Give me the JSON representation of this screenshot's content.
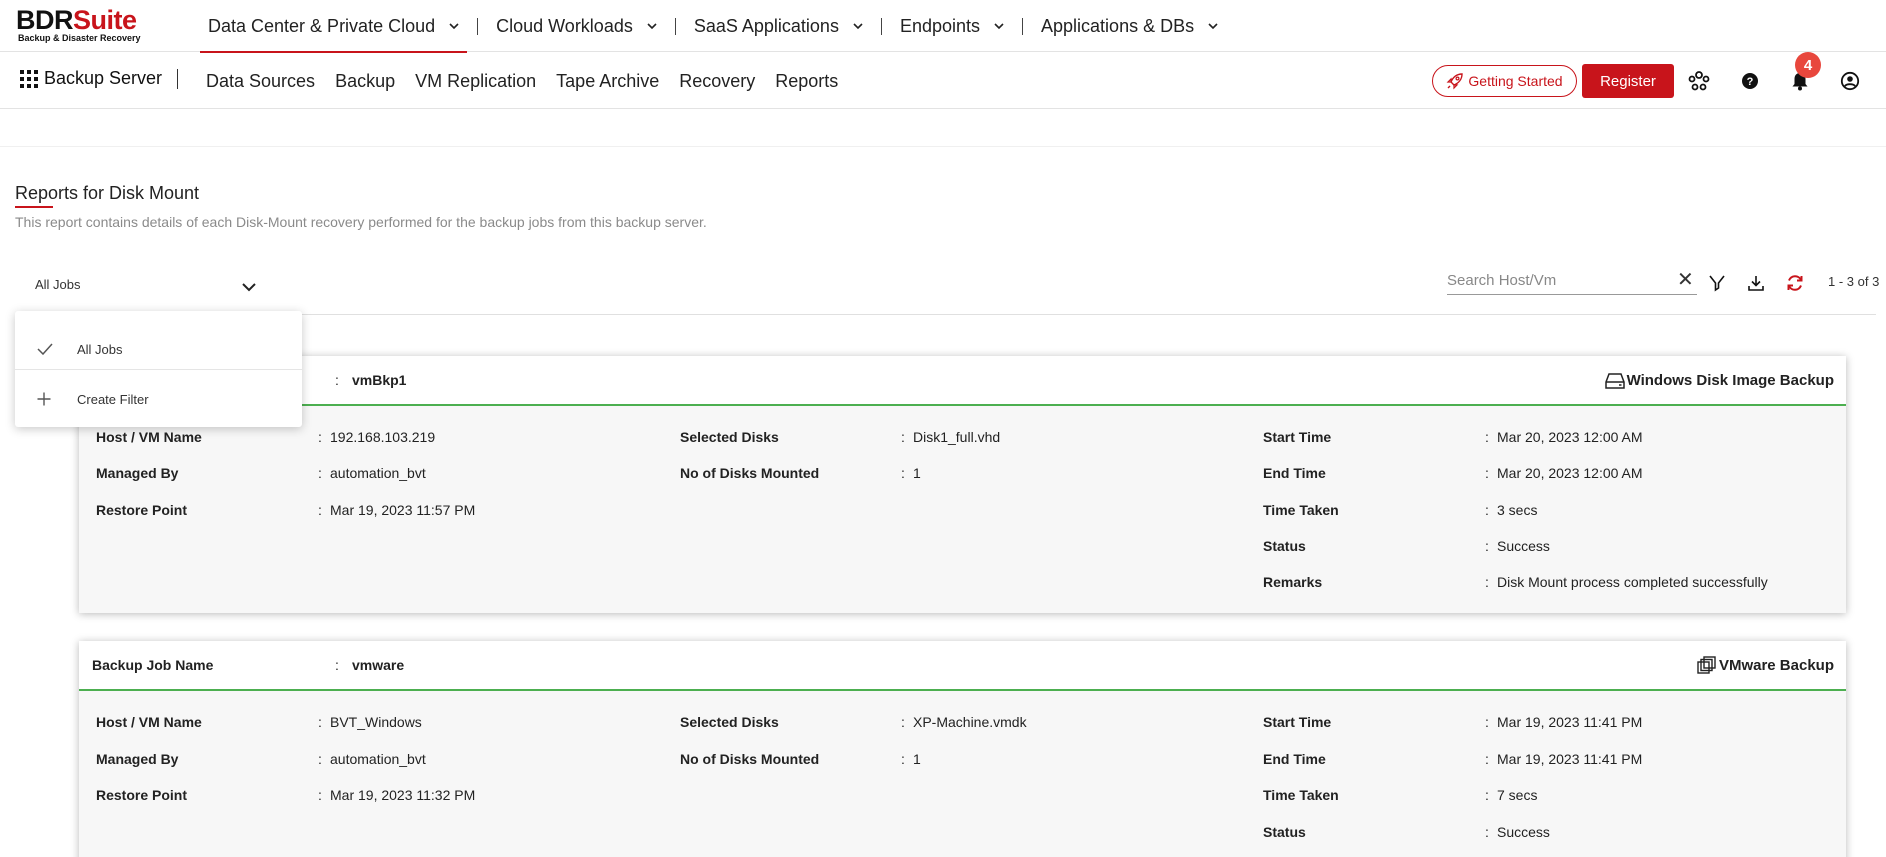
{
  "brand": {
    "name_a": "BDR",
    "name_b": "Suite",
    "tagline": "Backup & Disaster Recovery"
  },
  "topnav": [
    {
      "label": "Data Center & Private Cloud",
      "active": true
    },
    {
      "label": "Cloud Workloads"
    },
    {
      "label": "SaaS Applications"
    },
    {
      "label": "Endpoints"
    },
    {
      "label": "Applications & DBs"
    }
  ],
  "subnav": {
    "apps_label": "Backup Server",
    "items": [
      "Data Sources",
      "Backup",
      "VM Replication",
      "Tape Archive",
      "Recovery",
      "Reports"
    ]
  },
  "header_actions": {
    "getting_started": "Getting Started",
    "register": "Register",
    "notification_count": "4"
  },
  "page": {
    "title": "Reports for Disk Mount",
    "description": "This report contains details of each Disk-Mount recovery performed for the backup jobs from this backup server."
  },
  "filter": {
    "selected": "All Jobs",
    "search_placeholder": "Search Host/Vm",
    "pager": "1 - 3 of 3",
    "options": [
      {
        "label": "All Jobs",
        "icon": "check-icon"
      },
      {
        "label": "Create Filter",
        "icon": "plus-icon"
      }
    ]
  },
  "labels": {
    "job_name": "Backup Job Name",
    "host": "Host / VM Name",
    "managed_by": "Managed By",
    "restore_point": "Restore Point",
    "selected_disks": "Selected Disks",
    "disks_mounted": "No of Disks Mounted",
    "start_time": "Start Time",
    "end_time": "End Time",
    "time_taken": "Time Taken",
    "status": "Status",
    "remarks": "Remarks"
  },
  "jobs": [
    {
      "job_name": "vmBkp1",
      "type": "Windows Disk Image Backup",
      "type_icon": "disk-icon",
      "host": "192.168.103.219",
      "managed_by": "automation_bvt",
      "restore_point": "Mar 19, 2023 11:57 PM",
      "selected_disks": "Disk1_full.vhd",
      "disks_mounted": "1",
      "start_time": "Mar 20, 2023 12:00 AM",
      "end_time": "Mar 20, 2023 12:00 AM",
      "time_taken": "3 secs",
      "status": "Success",
      "remarks": "Disk Mount process completed successfully"
    },
    {
      "job_name": "vmware",
      "type": "VMware Backup",
      "type_icon": "vmware-icon",
      "host": "BVT_Windows",
      "managed_by": "automation_bvt",
      "restore_point": "Mar 19, 2023 11:32 PM",
      "selected_disks": "XP-Machine.vmdk",
      "disks_mounted": "1",
      "start_time": "Mar 19, 2023 11:41 PM",
      "end_time": "Mar 19, 2023 11:41 PM",
      "time_taken": "7 secs",
      "status": "Success"
    }
  ],
  "colors": {
    "brand_red": "#c8141b",
    "success_green": "#4caf50",
    "badge": "#e8473d"
  }
}
